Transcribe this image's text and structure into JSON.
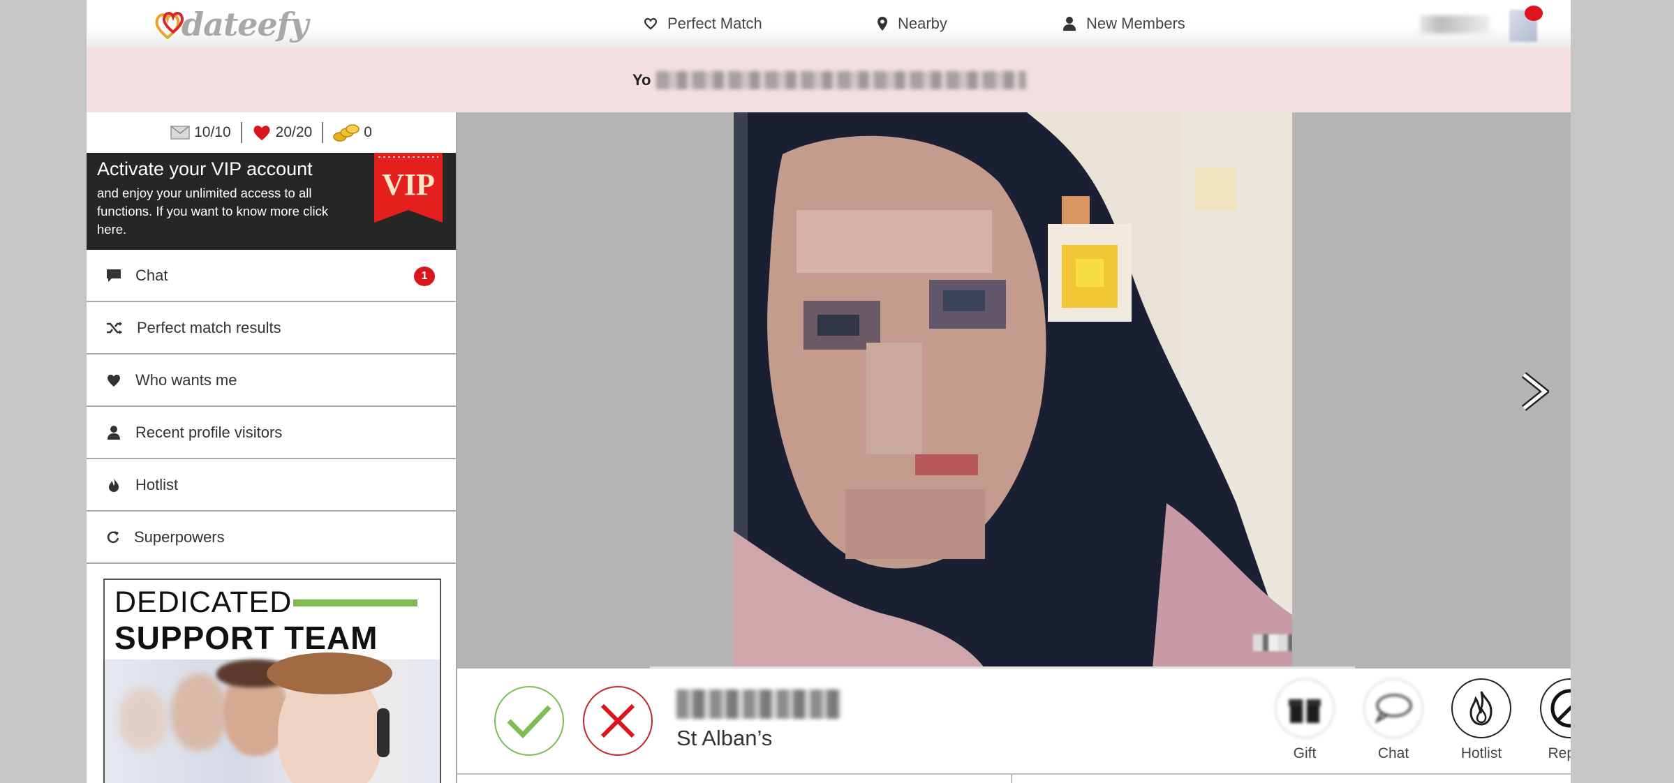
{
  "header": {
    "logo_text": "dateefy",
    "nav": [
      {
        "label": "Perfect Match",
        "icon": "heart-outline-icon"
      },
      {
        "label": "Nearby",
        "icon": "location-pin-icon"
      },
      {
        "label": "New Members",
        "icon": "person-icon"
      }
    ]
  },
  "banner": {
    "visible_text": "Yo"
  },
  "sidebar": {
    "stats": {
      "messages": "10/10",
      "likes": "20/20",
      "coins": "0"
    },
    "vip": {
      "title": "Activate your VIP account",
      "description": "and enjoy your unlimited access to all functions. If you want to know more click here.",
      "badge_text": "VIP"
    },
    "menu": [
      {
        "label": "Chat",
        "icon": "chat-bubble-icon",
        "badge": "1"
      },
      {
        "label": "Perfect match results",
        "icon": "shuffle-icon"
      },
      {
        "label": "Who wants me",
        "icon": "heart-icon"
      },
      {
        "label": "Recent profile visitors",
        "icon": "person-icon"
      },
      {
        "label": "Hotlist",
        "icon": "flame-icon"
      },
      {
        "label": "Superpowers",
        "icon": "refresh-icon"
      }
    ],
    "support": {
      "line1": "DEDICATED",
      "line2": "SUPPORT TEAM"
    }
  },
  "profile": {
    "city": "St Alban’s",
    "actions": [
      {
        "label": "Gift",
        "icon": "gift-icon"
      },
      {
        "label": "Chat",
        "icon": "chat-bubble-icon"
      },
      {
        "label": "Hotlist",
        "icon": "flame-icon"
      },
      {
        "label": "Report",
        "icon": "block-icon"
      }
    ]
  },
  "colors": {
    "brand_red": "#e0141e",
    "like_green": "#7cbd57",
    "nope_red": "#c0272d",
    "banner_pink": "#f3dfe0",
    "vip_dark": "#262626",
    "support_green": "#7dbc4f"
  }
}
